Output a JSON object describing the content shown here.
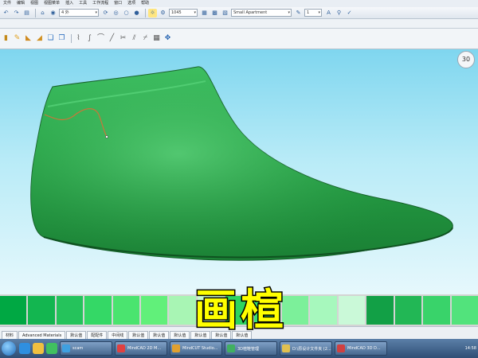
{
  "menubar": {
    "items": [
      "文件",
      "编辑",
      "视图",
      "视图菜单",
      "插入",
      "工具",
      "工作流程",
      "窗口",
      "选项",
      "帮助"
    ]
  },
  "toolbar1": {
    "layer_combo": "4 外",
    "unit_combo": "1045",
    "material_combo": "Small Apartment",
    "count_combo": "1"
  },
  "viewport": {
    "view_cube_label": "30",
    "background_top": "#7fd6ef",
    "shoe_color": "#2a9e44"
  },
  "swatches": [
    "#00a843",
    "#13b650",
    "#25c35c",
    "#34d866",
    "#4ae46f",
    "#61f07a",
    "#a8f5b4",
    "#c9fbd2",
    "#2ed460",
    "#38e070",
    "#7cf09a",
    "#a7f8bd",
    "#caf9d8",
    "#12a046",
    "#22b755",
    "#39d36a",
    "#52e37c"
  ],
  "overlay_title": "画楦",
  "tabs": [
    "材料",
    "Advanced Materials",
    "默认值",
    "配配件",
    "中间线",
    "默认值",
    "默认值",
    "默认值",
    "默认值",
    "默认值",
    "默认值"
  ],
  "taskbar": {
    "tasks": [
      {
        "label": "scam",
        "color": "#3fa0e0"
      },
      {
        "label": "MindCAD 2D M...",
        "color": "#e04040"
      },
      {
        "label": "MindCUT Studio...",
        "color": "#e0a030"
      },
      {
        "label": "3D楦鞋管理",
        "color": "#40b060"
      },
      {
        "label": "D:\\原设计文件夹 (2...",
        "color": "#e0c050"
      },
      {
        "label": "MindCAD 3D D...",
        "color": "#d04040"
      }
    ],
    "clock": "14:58"
  }
}
